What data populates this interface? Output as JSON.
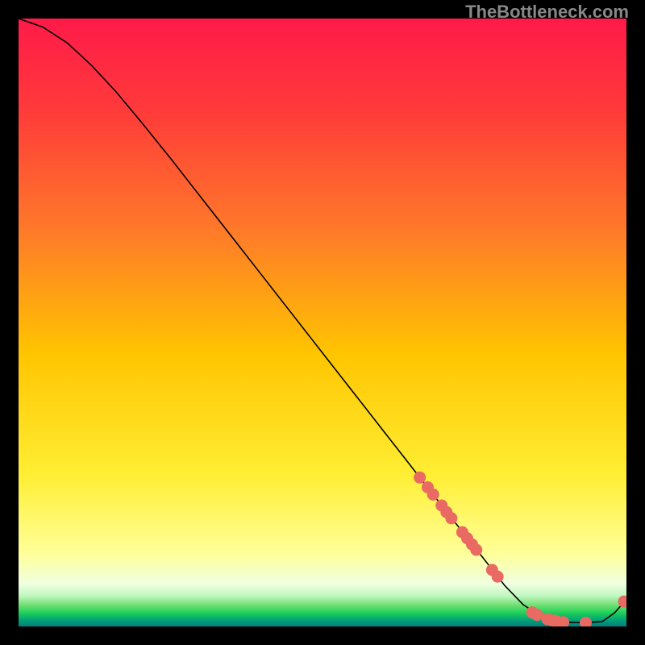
{
  "watermark": "TheBottleneck.com",
  "chart_data": {
    "type": "line",
    "title": "",
    "xlabel": "",
    "ylabel": "",
    "xlim": [
      0,
      100
    ],
    "ylim": [
      0,
      100
    ],
    "background_gradient": {
      "stops": [
        {
          "t": 0.0,
          "color": "#ff1a49"
        },
        {
          "t": 0.15,
          "color": "#ff3a3a"
        },
        {
          "t": 0.35,
          "color": "#ff7a29"
        },
        {
          "t": 0.55,
          "color": "#ffc400"
        },
        {
          "t": 0.75,
          "color": "#ffee33"
        },
        {
          "t": 0.88,
          "color": "#ffff99"
        },
        {
          "t": 0.93,
          "color": "#f0ffe0"
        },
        {
          "t": 0.95,
          "color": "#c0f7c0"
        },
        {
          "t": 0.965,
          "color": "#70e070"
        },
        {
          "t": 0.978,
          "color": "#1ecf5a"
        },
        {
          "t": 0.99,
          "color": "#00a078"
        },
        {
          "t": 1.0,
          "color": "#008080"
        }
      ]
    },
    "series": [
      {
        "name": "bottleneck-curve",
        "color": "#000000",
        "x": [
          0.0,
          4.0,
          8.0,
          12.0,
          16.0,
          20.0,
          25.0,
          30.0,
          35.0,
          40.0,
          45.0,
          50.0,
          55.0,
          60.0,
          65.0,
          70.0,
          73.0,
          76.0,
          80.0,
          83.0,
          86.0,
          90.0,
          93.0,
          96.0,
          98.0,
          100.0
        ],
        "y": [
          100.0,
          98.6,
          96.0,
          92.3,
          88.0,
          83.2,
          77.0,
          70.6,
          64.2,
          57.8,
          51.4,
          45.0,
          38.6,
          32.2,
          25.8,
          19.4,
          15.6,
          11.8,
          6.7,
          3.6,
          1.6,
          0.7,
          0.6,
          0.8,
          2.2,
          4.4
        ]
      }
    ],
    "markers": {
      "name": "highlighted-points",
      "color": "#e96a63",
      "radius": 7.5,
      "points": [
        {
          "x": 66.0,
          "y": 24.5
        },
        {
          "x": 67.3,
          "y": 22.9
        },
        {
          "x": 68.2,
          "y": 21.7
        },
        {
          "x": 69.6,
          "y": 19.9
        },
        {
          "x": 70.4,
          "y": 18.8
        },
        {
          "x": 71.2,
          "y": 17.8
        },
        {
          "x": 73.0,
          "y": 15.5
        },
        {
          "x": 73.8,
          "y": 14.5
        },
        {
          "x": 74.6,
          "y": 13.5
        },
        {
          "x": 75.3,
          "y": 12.6
        },
        {
          "x": 77.9,
          "y": 9.3
        },
        {
          "x": 78.8,
          "y": 8.2
        },
        {
          "x": 84.5,
          "y": 2.3
        },
        {
          "x": 85.3,
          "y": 1.9
        },
        {
          "x": 87.0,
          "y": 1.2
        },
        {
          "x": 87.8,
          "y": 1.0
        },
        {
          "x": 88.4,
          "y": 0.9
        },
        {
          "x": 89.6,
          "y": 0.7
        },
        {
          "x": 93.3,
          "y": 0.6
        },
        {
          "x": 99.6,
          "y": 4.1
        }
      ]
    }
  }
}
